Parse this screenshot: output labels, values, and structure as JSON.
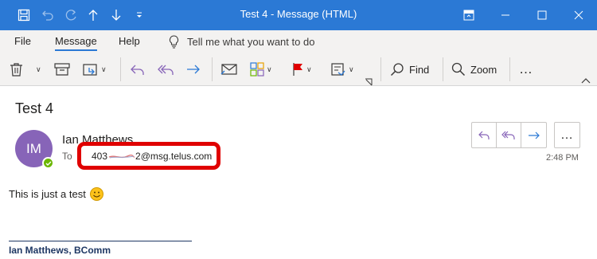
{
  "window": {
    "title": "Test 4  -  Message (HTML)",
    "accent": "#2b79d5"
  },
  "quick_access": {
    "icons": [
      "save-icon",
      "undo-icon",
      "redo-icon",
      "up-arrow-icon",
      "down-arrow-icon",
      "customize-icon"
    ]
  },
  "menu": {
    "tabs": [
      {
        "label": "File"
      },
      {
        "label": "Message",
        "active": true
      },
      {
        "label": "Help"
      }
    ],
    "tell_me": "Tell me what you want to do"
  },
  "ribbon": {
    "find_label": "Find",
    "zoom_label": "Zoom",
    "more_label": "…"
  },
  "message": {
    "subject": "Test 4",
    "avatar_initials": "IM",
    "sender_name": "Ian Matthews",
    "to_label": "To",
    "to_address_prefix": "403",
    "to_address_suffix": "2@msg.telus.com",
    "time": "2:48 PM",
    "body": "This is just a test",
    "signature_name": "Ian Matthews, BComm",
    "avatar_color": "#8764b8",
    "presence_color": "#6bb700",
    "highlight_color": "#e00000"
  }
}
